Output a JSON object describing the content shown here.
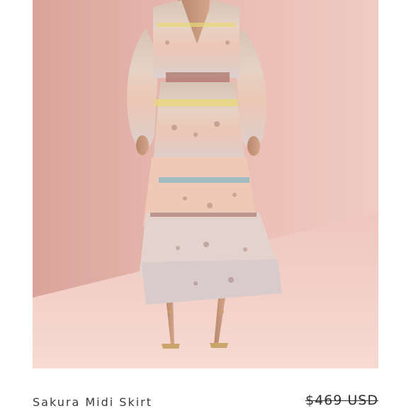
{
  "product": {
    "title": "Sakura Midi Skirt",
    "price": "$469 USD"
  },
  "colors": {
    "backdrop": "#e7b4aa",
    "floor": "#f0cbc2",
    "text": "#3a3a3a"
  }
}
